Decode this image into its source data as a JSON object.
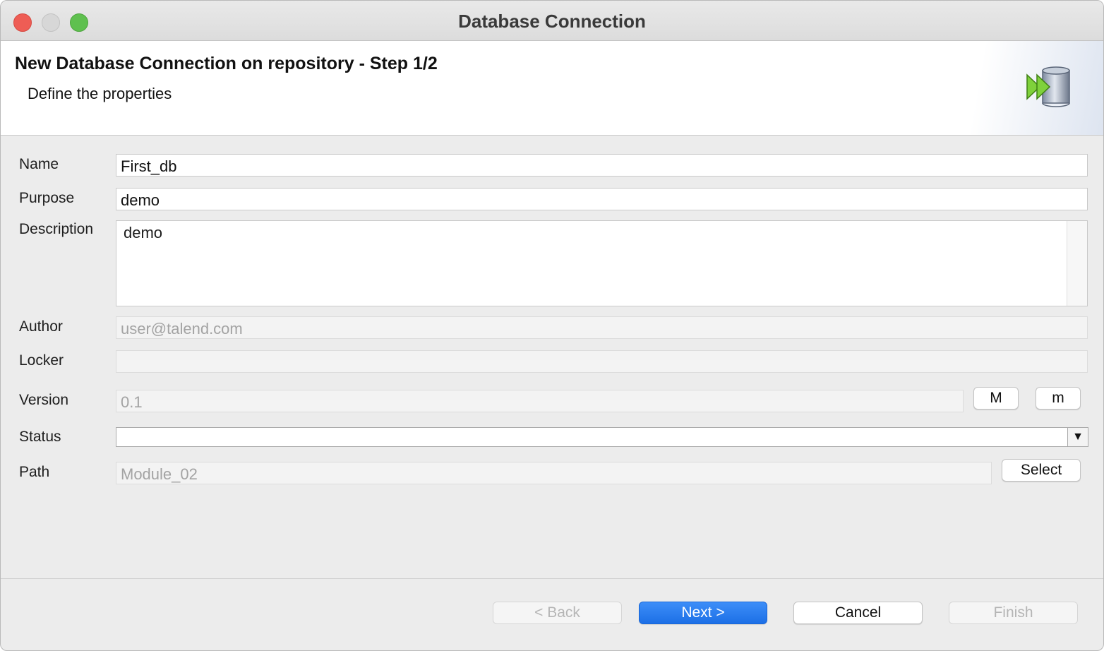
{
  "window": {
    "title": "Database Connection"
  },
  "banner": {
    "title": "New Database Connection on repository - Step 1/2",
    "subtitle": "Define the properties",
    "icon": "database-connection-icon"
  },
  "form": {
    "name": {
      "label": "Name",
      "value": "First_db"
    },
    "purpose": {
      "label": "Purpose",
      "value": "demo"
    },
    "description": {
      "label": "Description",
      "value": "demo"
    },
    "author": {
      "label": "Author",
      "value": "user@talend.com"
    },
    "locker": {
      "label": "Locker",
      "value": ""
    },
    "version": {
      "label": "Version",
      "value": "0.1",
      "major_label": "M",
      "minor_label": "m"
    },
    "status": {
      "label": "Status",
      "value": ""
    },
    "path": {
      "label": "Path",
      "value": "Module_02",
      "select_label": "Select"
    }
  },
  "footer": {
    "back_label": "< Back",
    "next_label": "Next >",
    "cancel_label": "Cancel",
    "finish_label": "Finish"
  },
  "colors": {
    "primary": "#1c6fe6",
    "close": "#ee5d55",
    "maximize": "#5fc04f"
  }
}
